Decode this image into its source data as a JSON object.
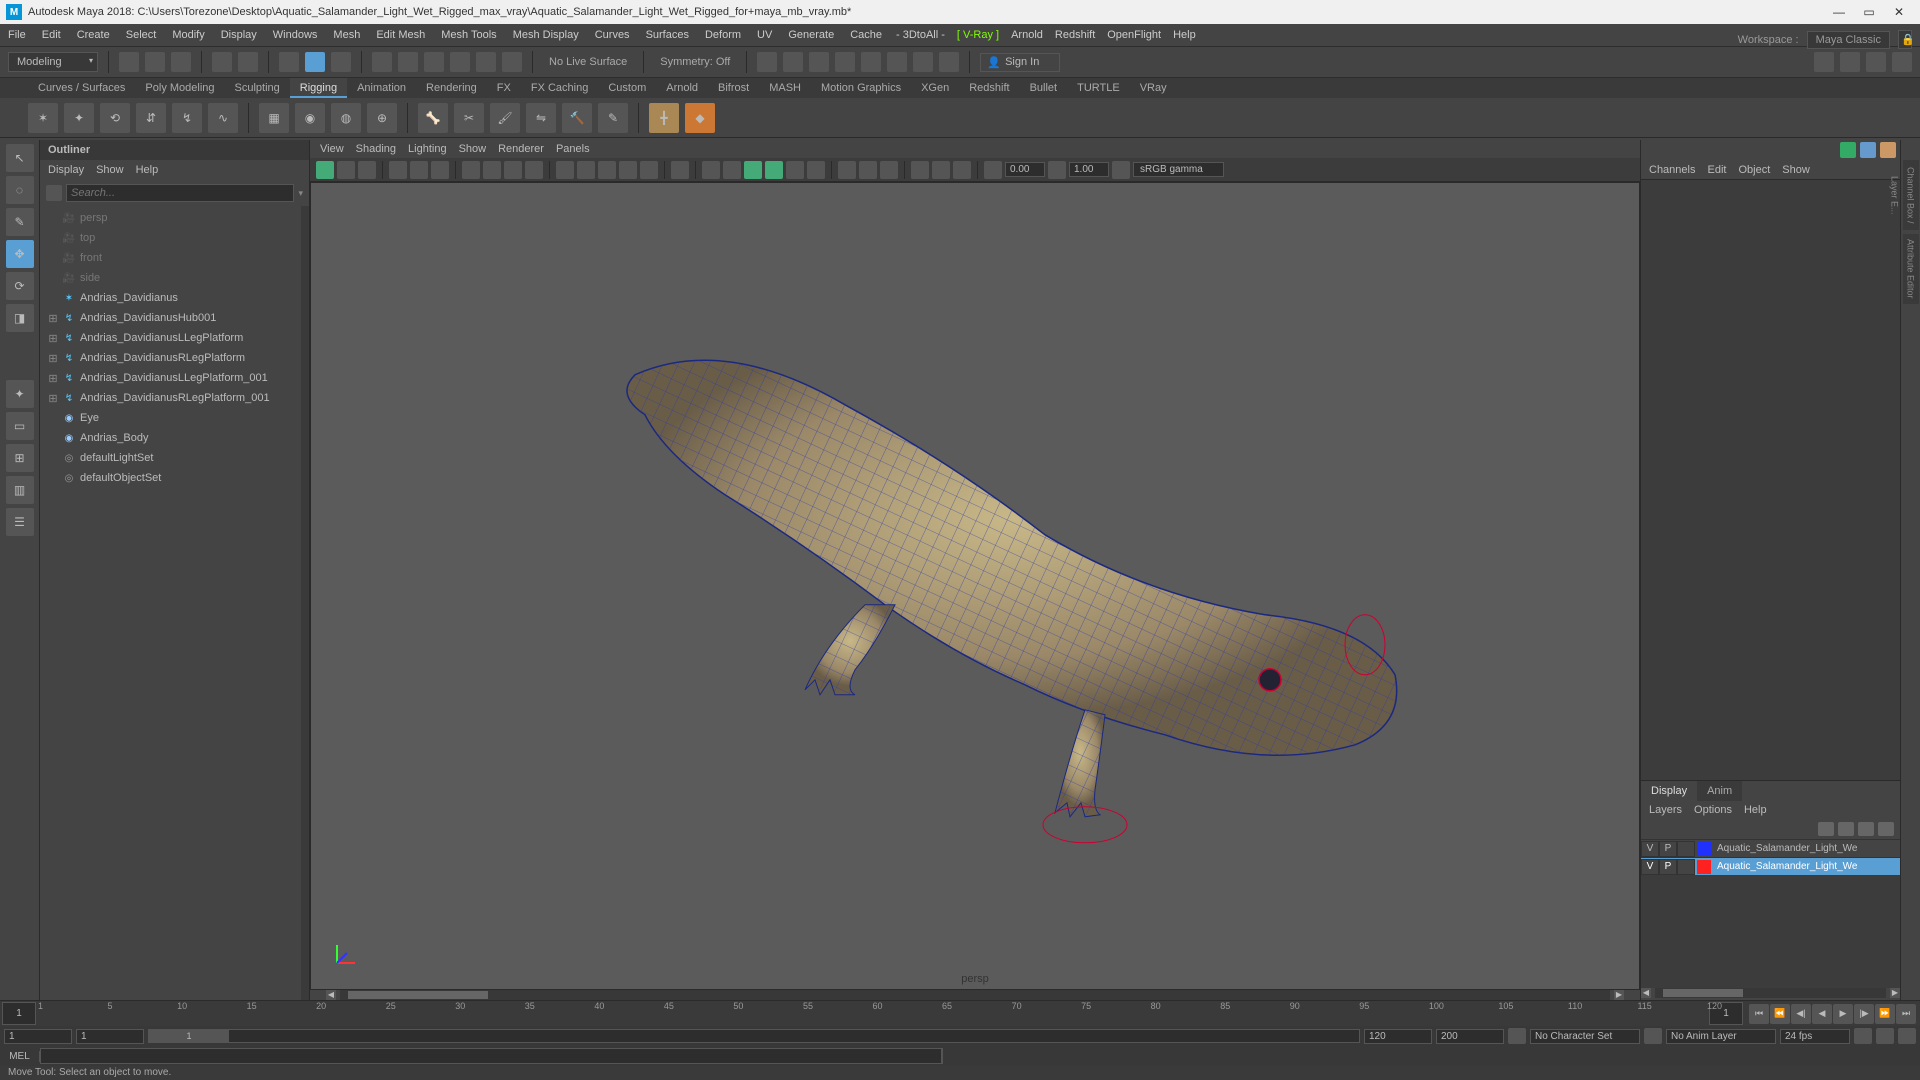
{
  "title_bar": {
    "app": "M",
    "text": "Autodesk Maya 2018: C:\\Users\\Torezone\\Desktop\\Aquatic_Salamander_Light_Wet_Rigged_max_vray\\Aquatic_Salamander_Light_Wet_Rigged_for+maya_mb_vray.mb*",
    "min": "—",
    "max": "▭",
    "close": "✕"
  },
  "menu_bar": {
    "items": [
      "File",
      "Edit",
      "Create",
      "Select",
      "Modify",
      "Display",
      "Windows",
      "Mesh",
      "Edit Mesh",
      "Mesh Tools",
      "Mesh Display",
      "Curves",
      "Surfaces",
      "Deform",
      "UV",
      "Generate",
      "Cache"
    ],
    "render_plugins": [
      "- 3DtoAll -",
      "[ V-Ray ]",
      "Arnold",
      "Redshift",
      "OpenFlight",
      "Help"
    ],
    "workspace_label": "Workspace :",
    "workspace_value": "Maya Classic"
  },
  "shelf_strip": {
    "mode": "Modeling",
    "live_surface": "No Live Surface",
    "symmetry": "Symmetry: Off",
    "signin": "Sign In"
  },
  "shelf_tabs": [
    "Curves / Surfaces",
    "Poly Modeling",
    "Sculpting",
    "Rigging",
    "Animation",
    "Rendering",
    "FX",
    "FX Caching",
    "Custom",
    "Arnold",
    "Bifrost",
    "MASH",
    "Motion Graphics",
    "XGen",
    "Redshift",
    "Bullet",
    "TURTLE",
    "VRay"
  ],
  "shelf_active_tab": "Rigging",
  "outliner": {
    "title": "Outliner",
    "menus": [
      "Display",
      "Show",
      "Help"
    ],
    "search_placeholder": "Search...",
    "nodes": [
      {
        "type": "cam",
        "label": "persp"
      },
      {
        "type": "cam",
        "label": "top"
      },
      {
        "type": "cam",
        "label": "front"
      },
      {
        "type": "cam",
        "label": "side"
      },
      {
        "type": "rig",
        "label": "Andrias_Davidianus",
        "exp": false
      },
      {
        "type": "rig",
        "label": "Andrias_DavidianusHub001",
        "exp": true
      },
      {
        "type": "rig",
        "label": "Andrias_DavidianusLLegPlatform",
        "exp": true
      },
      {
        "type": "rig",
        "label": "Andrias_DavidianusRLegPlatform",
        "exp": true
      },
      {
        "type": "rig",
        "label": "Andrias_DavidianusLLegPlatform_001",
        "exp": true
      },
      {
        "type": "rig",
        "label": "Andrias_DavidianusRLegPlatform_001",
        "exp": true
      },
      {
        "type": "obj",
        "label": "Eye"
      },
      {
        "type": "obj",
        "label": "Andrias_Body"
      },
      {
        "type": "set",
        "label": "defaultLightSet"
      },
      {
        "type": "set",
        "label": "defaultObjectSet"
      }
    ]
  },
  "viewport": {
    "menus": [
      "View",
      "Shading",
      "Lighting",
      "Show",
      "Renderer",
      "Panels"
    ],
    "exposure": "0.00",
    "gamma": "1.00",
    "color_space": "sRGB gamma",
    "label": "persp"
  },
  "right_panel": {
    "menus": [
      "Channels",
      "Edit",
      "Object",
      "Show"
    ],
    "layer_tabs": [
      "Display",
      "Anim"
    ],
    "layer_menus": [
      "Layers",
      "Options",
      "Help"
    ],
    "layers": [
      {
        "v": "V",
        "p": "P",
        "color": "#2030ff",
        "name": "Aquatic_Salamander_Light_We",
        "sel": false
      },
      {
        "v": "V",
        "p": "P",
        "color": "#ff2020",
        "name": "Aquatic_Salamander_Light_We",
        "sel": true
      }
    ]
  },
  "right_tabs": [
    "Channel Box / Layer E...",
    "Attribute Editor"
  ],
  "timeline": {
    "start_field": "1",
    "end_field": "1",
    "ticks": [
      "1",
      "5",
      "10",
      "15",
      "20",
      "25",
      "30",
      "35",
      "40",
      "45",
      "50",
      "55",
      "60",
      "65",
      "70",
      "75",
      "80",
      "85",
      "90",
      "95",
      "100",
      "105",
      "110",
      "115",
      "120"
    ],
    "range_start": "1",
    "range_inner_start": "1",
    "range_slider_label": "1",
    "range_inner_end": "120",
    "range_end": "200",
    "char_set": "No Character Set",
    "anim_layer": "No Anim Layer",
    "fps": "24 fps"
  },
  "cmd": {
    "label": "MEL"
  },
  "help_line": "Move Tool: Select an object to move."
}
